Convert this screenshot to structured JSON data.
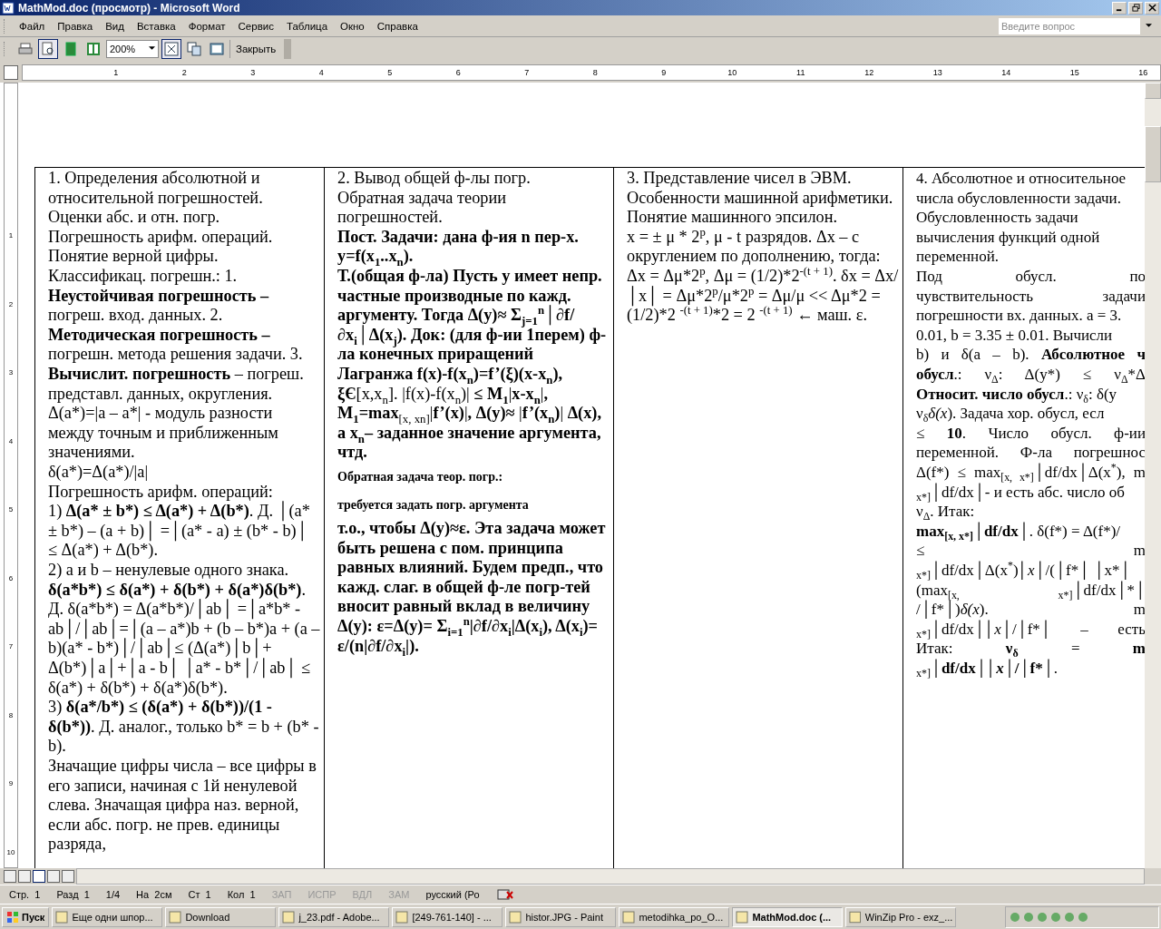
{
  "window": {
    "title": "MathMod.doc (просмотр) - Microsoft Word"
  },
  "menu": [
    "Файл",
    "Правка",
    "Вид",
    "Вставка",
    "Формат",
    "Сервис",
    "Таблица",
    "Окно",
    "Справка"
  ],
  "help_search": {
    "placeholder": "Введите вопрос"
  },
  "toolbar": {
    "zoom": "200%",
    "close_label": "Закрыть"
  },
  "ruler": {
    "numbers": [
      "1",
      "2",
      "3",
      "4",
      "5",
      "6",
      "7",
      "8",
      "9",
      "10",
      "11",
      "12",
      "13",
      "14",
      "15",
      "16"
    ]
  },
  "vertical_ruler": {
    "numbers": [
      "1",
      "2",
      "3",
      "4",
      "5",
      "6",
      "7",
      "8",
      "9",
      "10"
    ]
  },
  "columns": [
    {
      "paragraphs": [
        {
          "kind": "normal",
          "text": "1. Определения абсолютной и относительной погрешностей."
        },
        {
          "kind": "normal",
          "text": "Оценки абс. и отн. погр."
        },
        {
          "kind": "normal",
          "text": "Погрешность арифм. операций."
        },
        {
          "kind": "normal",
          "text": "Понятие верной цифры."
        },
        {
          "kind": "normal",
          "text": "Классификац. погрешн.: 1. **Неустойчивая погрешность –** погреш. вход. данных. 2. **Методическая погрешность –** погрешн. метода решения задачи. 3. **Вычислит. погрешность** – погреш. представл. данных, округления."
        },
        {
          "kind": "normal",
          "text": "Δ(a*)=|a – a*| - модуль разности между точным и приближенным значениями."
        },
        {
          "kind": "normal",
          "text": "δ(a*)=Δ(a*)/|a|"
        },
        {
          "kind": "normal",
          "text": "Погрешность арифм. операций:"
        },
        {
          "kind": "normal",
          "text": "1) **Δ(a* ± b*) ≤ Δ(a*) + Δ(b*)**. Д. │(a* ± b*) – (a + b)│ =│(a* - a) ± (b* - b)│ ≤ Δ(a*) + Δ(b*)."
        },
        {
          "kind": "normal",
          "text": "2) a и b – ненулевые одного знака."
        },
        {
          "kind": "normal",
          "text": "**δ(a*b*) ≤ δ(a*) + δ(b*) + δ(a*)δ(b*)**. Д. δ(a*b*) = Δ(a*b*)/│ab│ =│a*b* - ab│/│ab│=│(a – a*)b + (b – b*)a + (a – b)(a* - b*)│/│ab│≤ (Δ(a*)│b│+ Δ(b*)│a│+│a - b│ │a* - b*│/│ab│ ≤ δ(a*) + δ(b*) + δ(a*)δ(b*)."
        },
        {
          "kind": "normal",
          "text": "3) **δ(a*/b*) ≤ (δ(a*) + δ(b*))/(1 - δ(b*))**. Д. аналог., только b* = b + (b* - b)."
        },
        {
          "kind": "normal",
          "text": "Значащие цифры числа – все цифры в его записи, начиная с 1й ненулевой слева. Значащая цифра наз. верной, если абс. погр. не прев. единицы разряда,"
        }
      ]
    },
    {
      "paragraphs": [
        {
          "kind": "normal",
          "text": "2. Вывод общей ф-лы погр."
        },
        {
          "kind": "normal",
          "text": "Обратная задача теории погрешностей."
        },
        {
          "kind": "bold",
          "text": "Пост. Задачи: дана ф-ия n пер-х."
        },
        {
          "kind": "bold",
          "text": "y=f(x$_{1}$..x$_{n}$)."
        },
        {
          "kind": "normal",
          "text": "**Т.(общая ф-ла) Пусть у имеет непр. частные производные по кажд. аргументу. Тогда  Δ(y)≈ Σ$_{j=1}$$^{n}$│∂f/∂x$_{i}$│Δ(x$_{j}$). Док: (для ф-ии 1перем) ф-ла конечных приращений Лагранжа f(x)-f(x$_{n}$)=f’(ξ)(x-x$_{n}$),  ξЄ**[x,x$_{n}$]. |f(x)-f(x$_{n}$)| **≤ M$_{1}$**|**x-x$_{n}$**|**, M$_{1}$=max**$_{[x, xn]}$|**f’(x)**|**, Δ(y)≈** |**f’(x$_{n}$)**| **Δ(x), а x$_{n}$– заданное значение аргумента, чтд.**"
        },
        {
          "kind": "small",
          "text": "Обратная задача теор. погр.:"
        },
        {
          "kind": "small",
          "text": "требуется задать погр. аргумента"
        },
        {
          "kind": "bold",
          "text": "т.о., чтобы Δ(y)≈ε. Эта задача может быть решена с пом. принципа равных влияний. Будем предп., что кажд. слаг. в общей ф-ле погр-тей вносит равный вклад в величину  Δ(y): ε=Δ(y)= Σ$_{i=1}$$^{n}$|∂f/∂x$_{i}$|Δ(x$_{i}$), Δ(x$_{i}$)= ε/(n|∂f/∂x$_{i}$|)."
        }
      ]
    },
    {
      "paragraphs": [
        {
          "kind": "normal",
          "text": "3. Представление чисел в ЭВМ. Особенности машинной арифметики. Понятие машинного эпсилон."
        },
        {
          "kind": "normal",
          "text": "x = ± μ * 2$^{p}$, μ - t разрядов. Δx – c округлением по дополнению, тогда: Δx = Δμ*2$^{p}$, Δμ = (1/2)*2$^{-(t + 1)}$. δx = Δx/│x│ = Δμ*2$^{p}$/μ*2$^{p}$ = Δμ/μ << Δμ*2 = (1/2)*2 $^{-(t + 1)}$*2 = 2 $^{-(t + 1)}$ ← маш. ε."
        }
      ]
    },
    {
      "lines": [
        {
          "kind": "plain",
          "text": "4. Абсолютное и относительное"
        },
        {
          "kind": "plain",
          "text": "числа обусловленности задачи."
        },
        {
          "kind": "plain",
          "text": "Обусловленность задачи"
        },
        {
          "kind": "plain",
          "text": "вычисления функций одной"
        },
        {
          "kind": "plain",
          "text": "переменной."
        },
        {
          "kind": "justify",
          "text": "Под обусл. по"
        },
        {
          "kind": "justify",
          "text": "чувствительность задачи"
        },
        {
          "kind": "plain",
          "text": "погрешности вх. данных. a = 3."
        },
        {
          "kind": "plain",
          "text": "0.01, b = 3.35 ± 0.01. Вычисли"
        },
        {
          "kind": "justify",
          "text": "b) и δ(a – b). **Абсолютное ч**"
        },
        {
          "kind": "justify",
          "text": "**обусл**.: ν$_{Δ}$: Δ(y*) ≤ ν$_{Δ}$*Δ"
        },
        {
          "kind": "plain",
          "text": "**Относит. число обусл**.: ν$_{δ}$: δ(y"
        },
        {
          "kind": "plain",
          "text": "ν$_{δ}$*δ(x*). Задача хор. обусл, есл"
        },
        {
          "kind": "justify",
          "text": "≤ **10**. Число обусл. ф-ии"
        },
        {
          "kind": "justify",
          "text": "переменной. Ф-ла погрешнос"
        },
        {
          "kind": "justify",
          "text": "Δ(f*) ≤ max$_{[x, x*]}$│df/dx│Δ(x$^{*}$), m"
        },
        {
          "kind": "plain",
          "text": "$_{x*]}$│df/dx│- и есть абс. число об"
        },
        {
          "kind": "plain",
          "text": "ν$_{Δ}$. Итак:"
        },
        {
          "kind": "plain",
          "text": "**max$_{[x, x*]}$│df/dx│**.  δ(f*) = Δ(f*)/"
        },
        {
          "kind": "justify",
          "text": "≤ m"
        },
        {
          "kind": "plain",
          "text": "$_{x*]}$│df/dx│Δ(x$^{*}$)*│x*│/(│f*│ │x*│"
        },
        {
          "kind": "justify",
          "text": "(max$_{[x, x*]}$│df/dx│*│"
        },
        {
          "kind": "justify",
          "text": "/│f*│)*δ(x*). m"
        },
        {
          "kind": "justify",
          "text": "$_{x*]}$│df/dx│*│x*│/│f*│ – есть"
        },
        {
          "kind": "justify",
          "text": "Итак: **ν$_{δ}$** = **m**"
        },
        {
          "kind": "plain",
          "text": "$_{x*]}$**│df/dx│*│x*│/│f*│**."
        }
      ]
    }
  ],
  "status_bar": [
    {
      "text": "Стр.  1",
      "disabled": false
    },
    {
      "text": "Разд  1",
      "disabled": false
    },
    {
      "text": "1/4",
      "disabled": false
    },
    {
      "text": "На  2см",
      "disabled": false
    },
    {
      "text": "Ст  1",
      "disabled": false
    },
    {
      "text": "Кол  1",
      "disabled": false
    },
    {
      "text": "ЗАП",
      "disabled": true
    },
    {
      "text": "ИСПР",
      "disabled": true
    },
    {
      "text": "ВДЛ",
      "disabled": true
    },
    {
      "text": "ЗАМ",
      "disabled": true
    },
    {
      "text": "русский (Ро",
      "disabled": false
    }
  ],
  "taskbar": {
    "start": "Пуск",
    "tasks": [
      {
        "label": "Еще одни шпор...",
        "selected": false
      },
      {
        "label": "Download",
        "selected": false
      },
      {
        "label": "j_23.pdf - Adobe...",
        "selected": false
      },
      {
        "label": "[249-761-140] - ...",
        "selected": false
      },
      {
        "label": "histor.JPG - Paint",
        "selected": false
      },
      {
        "label": "metodihka_po_O...",
        "selected": false
      },
      {
        "label": "MathMod.doc (...",
        "selected": true
      },
      {
        "label": "WinZip Pro - exz_...",
        "selected": false
      }
    ]
  }
}
